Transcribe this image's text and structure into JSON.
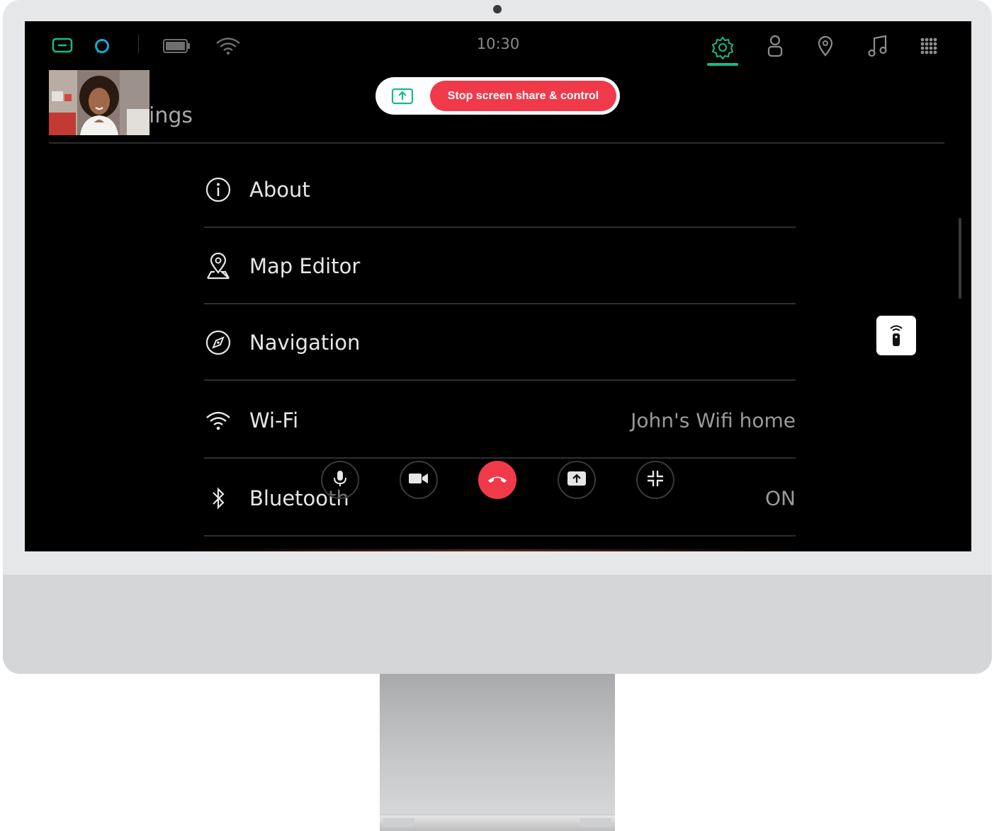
{
  "status_bar": {
    "time": "10:30",
    "icons": [
      "app-badge-icon",
      "alexa-ring-icon",
      "battery-icon",
      "wifi-icon"
    ],
    "nav_tabs": [
      "settings-gear-icon",
      "person-icon",
      "location-pin-icon",
      "music-note-icon",
      "apps-grid-icon"
    ],
    "active_tab": "settings-gear-icon",
    "accent_color": "#1bb88a"
  },
  "screen_share": {
    "stop_label": "Stop screen share & control",
    "icon": "share-screen-icon",
    "button_color": "#f03a4a"
  },
  "page": {
    "title": "ings"
  },
  "settings_rows": [
    {
      "label": "About",
      "icon": "info-icon",
      "value": ""
    },
    {
      "label": "Map Editor",
      "icon": "map-editor-icon",
      "value": ""
    },
    {
      "label": "Navigation",
      "icon": "compass-icon",
      "value": ""
    },
    {
      "label": "Wi-Fi",
      "icon": "wifi-icon",
      "value": "John's Wifi home"
    },
    {
      "label": "Bluetooth",
      "icon": "bluetooth-icon",
      "value": "ON"
    }
  ],
  "call_controls": [
    "microphone-icon",
    "video-camera-icon",
    "end-call-icon",
    "share-screen-icon",
    "minimize-icon"
  ],
  "floating": {
    "remote_icon": "remote-control-icon"
  }
}
